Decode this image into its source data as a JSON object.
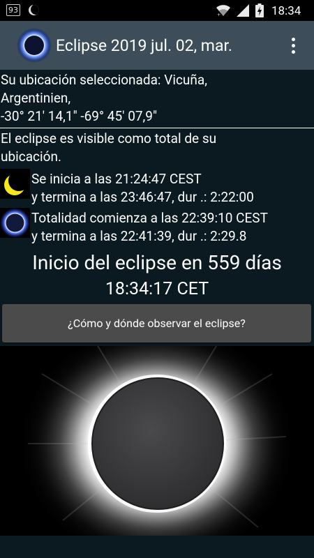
{
  "status_bar": {
    "badge": "93",
    "time": "18:34",
    "icons": [
      "notification-moon-icon",
      "wifi-icon",
      "signal-icon",
      "battery-charging-icon"
    ]
  },
  "app_bar": {
    "title": "Eclipse 2019 jul. 02, mar.",
    "icon": "eclipse-app-icon",
    "menu_icon": "more-vert-icon"
  },
  "location": {
    "line1": "Su ubicación seleccionada: Vicuña,",
    "line2": "Argentinien,",
    "line3": "-30° 21' 14,1\"  -69° 45' 07,9\""
  },
  "visibility": {
    "line1": "El eclipse es visible como total de su",
    "line2": "ubicación."
  },
  "partial": {
    "icon": "crescent-moon-icon",
    "line1": "Se inicia a las 21:24:47 CEST",
    "line2": "y termina a las 23:46:47, dur .: 2:22:00"
  },
  "totality": {
    "icon": "total-eclipse-icon",
    "line1": "Totalidad comienza a las 22:39:10 CEST",
    "line2": "y termina a las 22:41:39, dur .: 2:29.8"
  },
  "countdown": {
    "title": "Inicio del eclipse en 559 días",
    "clock": "18:34:17 CET"
  },
  "button": {
    "label": "¿Cómo y dónde observar el eclipse?"
  },
  "colors": {
    "background": "#0b1a20",
    "app_bar": "#3d4e5a",
    "button": "#4b4b4b",
    "moon": "#3a3a3c"
  }
}
